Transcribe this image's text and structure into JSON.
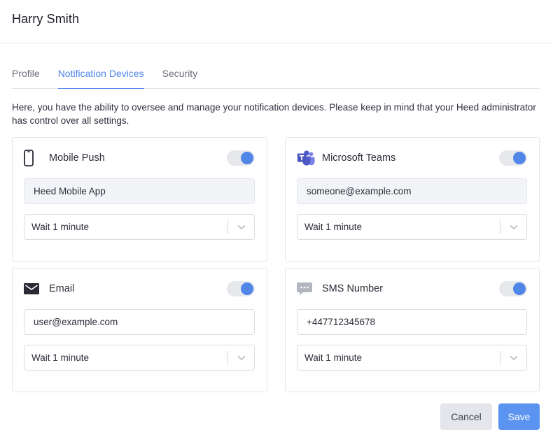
{
  "header": {
    "title": "Harry Smith"
  },
  "tabs": [
    {
      "label": "Profile"
    },
    {
      "label": "Notification Devices"
    },
    {
      "label": "Security"
    }
  ],
  "description": "Here, you have the ability to oversee and manage your notification devices. Please keep in mind that your Heed administrator has control over all settings.",
  "devices": {
    "mobile_push": {
      "title": "Mobile Push",
      "icon": "mobile-phone-icon",
      "enabled": true,
      "value": "Heed Mobile App",
      "delay": "Wait 1 minute"
    },
    "teams": {
      "title": "Microsoft Teams",
      "icon": "microsoft-teams-icon",
      "enabled": true,
      "value": "someone@example.com",
      "delay": "Wait 1 minute"
    },
    "email": {
      "title": "Email",
      "icon": "envelope-icon",
      "enabled": true,
      "value": "user@example.com",
      "delay": "Wait 1 minute"
    },
    "sms": {
      "title": "SMS Number",
      "icon": "chat-bubble-icon",
      "enabled": true,
      "value": "+447712345678",
      "delay": "Wait 1 minute"
    }
  },
  "actions": {
    "cancel_label": "Cancel",
    "save_label": "Save"
  },
  "colors": {
    "accent": "#4f86e8",
    "save_button": "#5b93f0",
    "teams_brand": "#5059c9"
  }
}
